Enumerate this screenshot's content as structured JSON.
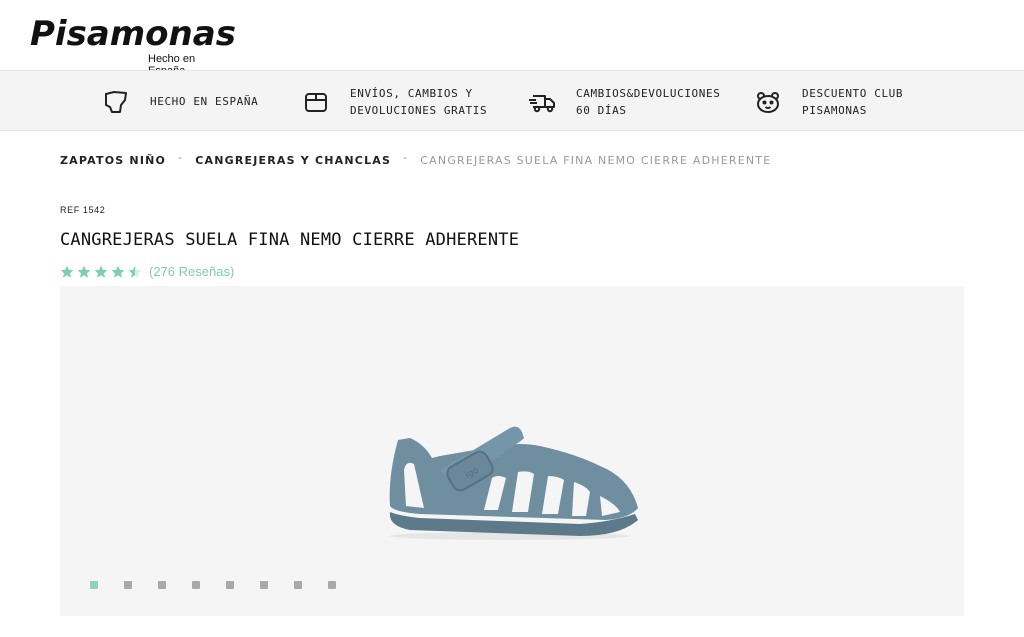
{
  "header": {
    "logo_text": "Pisamonas",
    "logo_subtitle": "Hecho en España"
  },
  "benefits": [
    {
      "icon": "spain-map-icon",
      "line1": "HECHO EN ESPAÑA",
      "line2": ""
    },
    {
      "icon": "box-icon",
      "line1": "ENVÍOS, CAMBIOS Y",
      "line2": "DEVOLUCIONES GRATIS"
    },
    {
      "icon": "delivery-truck-icon",
      "line1": "CAMBIOS&DEVOLUCIONES",
      "line2": "60 DÍAS"
    },
    {
      "icon": "bear-face-icon",
      "line1": "DESCUENTO CLUB",
      "line2": "PISAMONAS"
    }
  ],
  "breadcrumb": {
    "items": [
      "ZAPATOS NIÑO",
      "CANGREJERAS Y CHANCLAS",
      "CANGREJERAS SUELA FINA NEMO CIERRE ADHERENTE"
    ],
    "separator": "-"
  },
  "product": {
    "ref": "REF 1542",
    "title": "CANGREJERAS SUELA FINA NEMO CIERRE ADHERENTE",
    "rating": 4.5,
    "rating_max": 5,
    "reviews_text": "(276 Reseñas)"
  },
  "gallery": {
    "image_count": 8,
    "active_index": 0
  },
  "colors": {
    "accent": "#7fcfac",
    "benefits_bg": "#f4f4f4",
    "gallery_bg": "#f5f5f5",
    "shoe": "#6f8ea0"
  }
}
